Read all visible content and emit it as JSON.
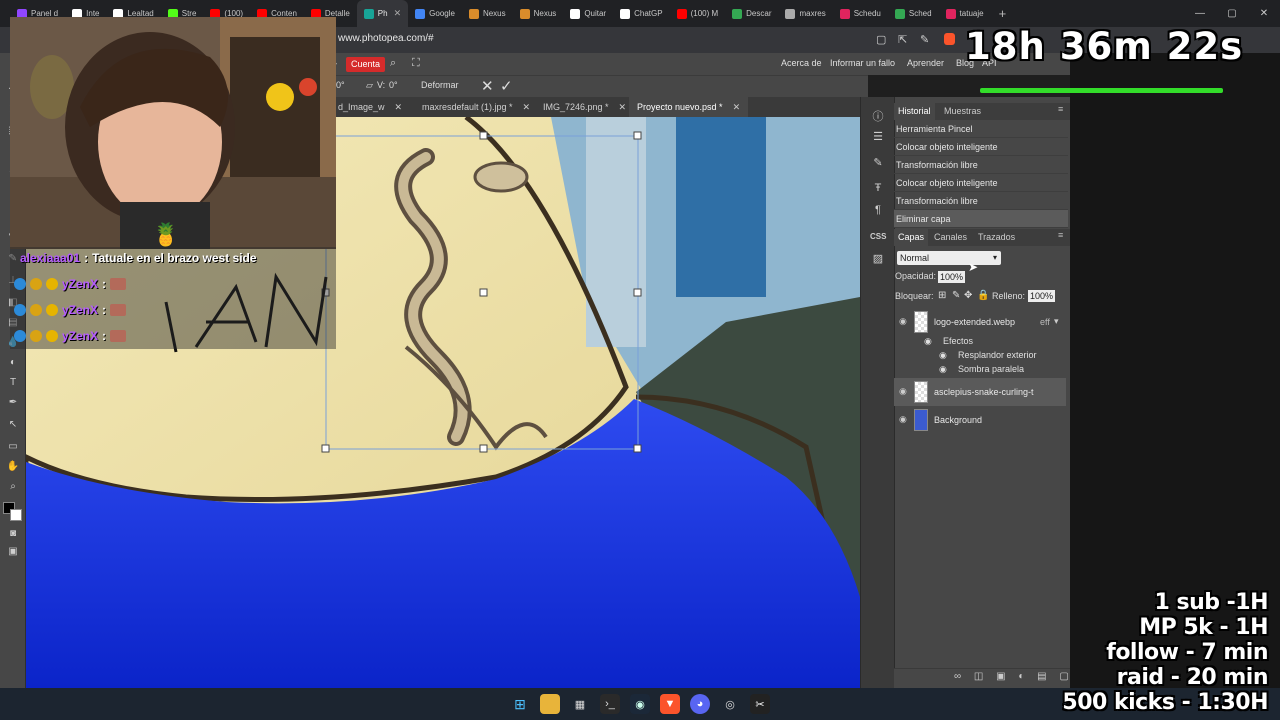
{
  "browser": {
    "tabs": [
      {
        "label": "Panel d",
        "color": "#9146ff"
      },
      {
        "label": "Inte",
        "color": "#ffffff"
      },
      {
        "label": "Lealtad",
        "color": "#ffffff"
      },
      {
        "label": "Stre",
        "color": "#53fc18"
      },
      {
        "label": "(100)",
        "color": "#ff0000"
      },
      {
        "label": "Conten",
        "color": "#ff0000"
      },
      {
        "label": "Detalle",
        "color": "#ff0000"
      },
      {
        "label": "Ph",
        "color": "#18a497",
        "active": true
      },
      {
        "label": "Google",
        "color": "#4285f4"
      },
      {
        "label": "Nexus",
        "color": "#d98c2b"
      },
      {
        "label": "Nexus",
        "color": "#d98c2b"
      },
      {
        "label": "Quitar",
        "color": "#ffffff"
      },
      {
        "label": "ChatGP",
        "color": "#ffffff"
      },
      {
        "label": "(100) M",
        "color": "#ff0000"
      },
      {
        "label": "Descar",
        "color": "#34a853"
      },
      {
        "label": "maxres",
        "color": "#aaaaaa"
      },
      {
        "label": "Schedu",
        "color": "#e0245e"
      },
      {
        "label": "Sched",
        "color": "#34a853"
      },
      {
        "label": "tatuaje",
        "color": "#e0245e"
      }
    ],
    "new_tab": "+",
    "url": "www.photopea.com/#"
  },
  "photopea": {
    "account_button": "Cuenta",
    "menu_links": [
      "Acerca de",
      "Informar un fallo",
      "Aprender",
      "Blog",
      "API"
    ],
    "options": {
      "h_value": "0°",
      "v_label": "V:",
      "v_value": "0°",
      "warp": "Deformar"
    },
    "doc_tabs": [
      {
        "label": "d_Image_w",
        "active": false
      },
      {
        "label": "maxresdefault (1).jpg *",
        "active": false
      },
      {
        "label": "IMG_7246.png *",
        "active": false
      },
      {
        "label": "Proyecto nuevo.psd *",
        "active": true
      }
    ],
    "history": {
      "tabs": [
        "Historial",
        "Muestras"
      ],
      "items": [
        "Herramienta Pincel",
        "Colocar objeto inteligente",
        "Transformación libre",
        "Colocar objeto inteligente",
        "Transformación libre",
        "Eliminar capa"
      ]
    },
    "layers_panel": {
      "tabs": [
        "Capas",
        "Canales",
        "Trazados"
      ],
      "blend_mode": "Normal",
      "opacity_label": "Opacidad:",
      "opacity_value": "100%",
      "lock_label": "Bloquear:",
      "fill_label": "Relleno:",
      "fill_value": "100%",
      "layers": [
        {
          "name": "logo-extended.webp",
          "fx": "eff"
        },
        {
          "name": "asclepius-snake-curling-t"
        },
        {
          "name": "Background"
        }
      ],
      "effects_label": "Efectos",
      "effects": [
        "Resplandor exterior",
        "Sombra paralela"
      ]
    },
    "side_label": "CSS"
  },
  "stream": {
    "timer": "18h 36m 22s",
    "timer_progress": 0.97,
    "goals": [
      "1 sub -1H",
      "MP 5k - 1H",
      "follow - 7 min",
      "raid - 20 min",
      "500 kicks - 1:30H"
    ],
    "chat": [
      {
        "user": "alexiaaa01",
        "message": "Tatuale en el brazo west side"
      },
      {
        "user": "yZenX",
        "message": ""
      },
      {
        "user": "yZenX",
        "message": ""
      },
      {
        "user": "yZenX",
        "message": ""
      }
    ],
    "canvas_text": "IVAN"
  },
  "colors": {
    "accent_red": "#d52b2b",
    "panel_bg": "#474747",
    "shirt_blue": "#1030d8",
    "timer_green": "#33dd2a",
    "chat_user": "#b55bff"
  }
}
